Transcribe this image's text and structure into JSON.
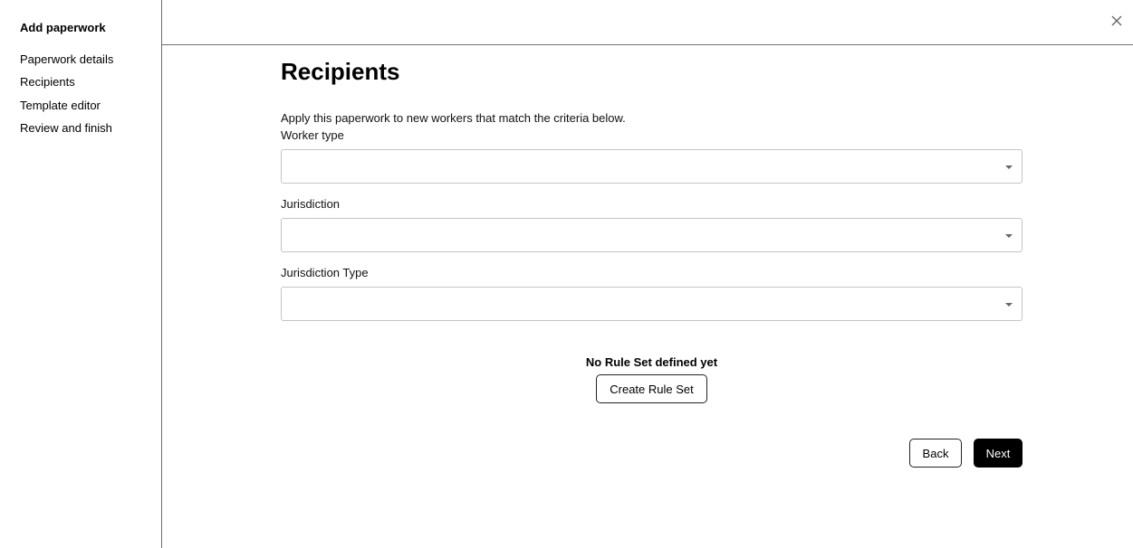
{
  "sidebar": {
    "title": "Add paperwork",
    "items": [
      {
        "label": "Paperwork details"
      },
      {
        "label": "Recipients"
      },
      {
        "label": "Template editor"
      },
      {
        "label": "Review and finish"
      }
    ]
  },
  "header": {
    "close_icon": "close-icon"
  },
  "main": {
    "title": "Recipients",
    "description": "Apply this paperwork to new workers that match the criteria below.",
    "fields": [
      {
        "label": "Worker type",
        "value": ""
      },
      {
        "label": "Jurisdiction",
        "value": ""
      },
      {
        "label": "Jurisdiction Type",
        "value": ""
      }
    ],
    "empty_state": "No Rule Set defined yet",
    "create_rule_set_label": "Create Rule Set",
    "back_label": "Back",
    "next_label": "Next"
  }
}
